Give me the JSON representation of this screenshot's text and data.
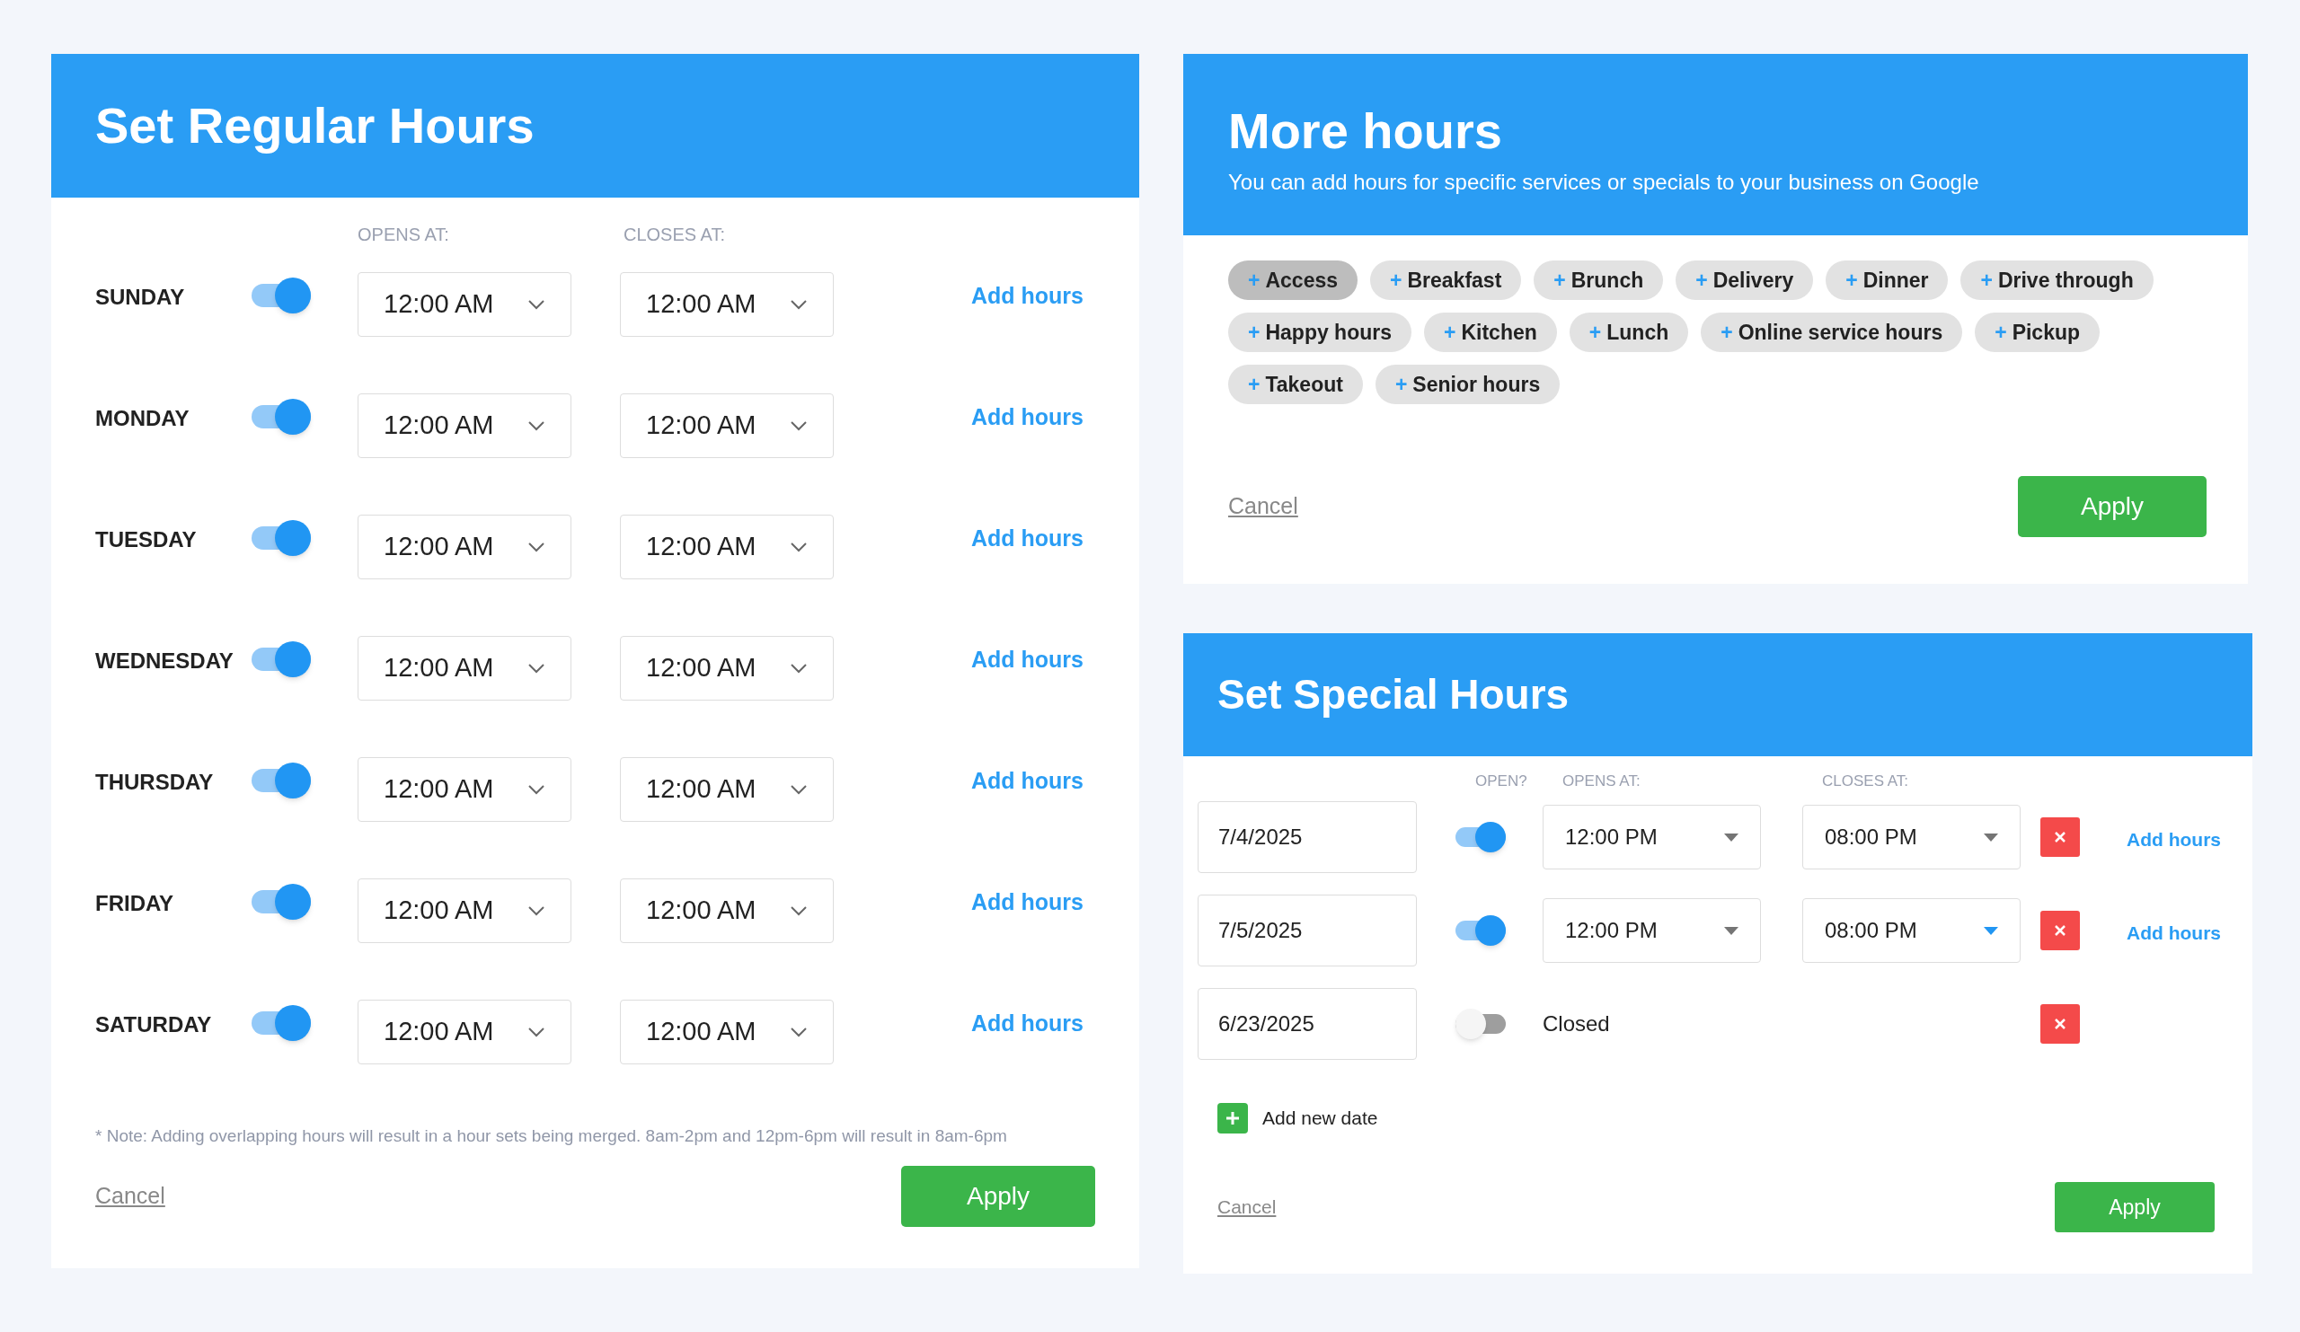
{
  "regular_hours": {
    "title": "Set Regular Hours",
    "columns": [
      "OPENS AT:",
      "CLOSES AT:"
    ],
    "days": [
      {
        "name": "SUNDAY",
        "on": true,
        "opens": "12:00 AM",
        "closes": "12:00 AM",
        "action": "Add hours"
      },
      {
        "name": "MONDAY",
        "on": true,
        "opens": "12:00 AM",
        "closes": "12:00 AM",
        "action": "Add hours"
      },
      {
        "name": "TUESDAY",
        "on": true,
        "opens": "12:00 AM",
        "closes": "12:00 AM",
        "action": "Add hours"
      },
      {
        "name": "WEDNESDAY",
        "on": true,
        "opens": "12:00 AM",
        "closes": "12:00 AM",
        "action": "Add hours"
      },
      {
        "name": "THURSDAY",
        "on": true,
        "opens": "12:00 AM",
        "closes": "12:00 AM",
        "action": "Add hours"
      },
      {
        "name": "FRIDAY",
        "on": true,
        "opens": "12:00 AM",
        "closes": "12:00 AM",
        "action": "Add hours"
      },
      {
        "name": "SATURDAY",
        "on": true,
        "opens": "12:00 AM",
        "closes": "12:00 AM",
        "action": "Add hours"
      }
    ],
    "note": "* Note: Adding overlapping hours will result in a hour sets being merged. 8am-2pm and 12pm-6pm will result in 8am-6pm",
    "cancel": "Cancel",
    "apply": "Apply"
  },
  "more_hours": {
    "title": "More hours",
    "subtitle": "You can add hours for specific services or specials to your business on Google",
    "chips": [
      {
        "label": "Access",
        "selected": true
      },
      {
        "label": "Breakfast",
        "selected": false
      },
      {
        "label": "Brunch",
        "selected": false
      },
      {
        "label": "Delivery",
        "selected": false
      },
      {
        "label": "Dinner",
        "selected": false
      },
      {
        "label": "Drive through",
        "selected": false
      },
      {
        "label": "Happy hours",
        "selected": false
      },
      {
        "label": "Kitchen",
        "selected": false
      },
      {
        "label": "Lunch",
        "selected": false
      },
      {
        "label": "Online service hours",
        "selected": false
      },
      {
        "label": "Pickup",
        "selected": false
      },
      {
        "label": "Takeout",
        "selected": false
      },
      {
        "label": "Senior hours",
        "selected": false
      }
    ],
    "chip_icon": "+",
    "cancel": "Cancel",
    "apply": "Apply"
  },
  "special_hours": {
    "title": "Set Special Hours",
    "columns": [
      "OPEN?",
      "OPENS AT:",
      "CLOSES AT:"
    ],
    "rows": [
      {
        "date": "7/4/2025",
        "on": true,
        "opens": "12:00 PM",
        "closes": "08:00 PM",
        "closes_focused": false,
        "action": "Add hours"
      },
      {
        "date": "7/5/2025",
        "on": true,
        "opens": "12:00 PM",
        "closes": "08:00 PM",
        "closes_focused": true,
        "action": "Add hours"
      },
      {
        "date": "6/23/2025",
        "on": false,
        "closed_label": "Closed"
      }
    ],
    "add_date": "Add new date",
    "cancel": "Cancel",
    "apply": "Apply"
  }
}
